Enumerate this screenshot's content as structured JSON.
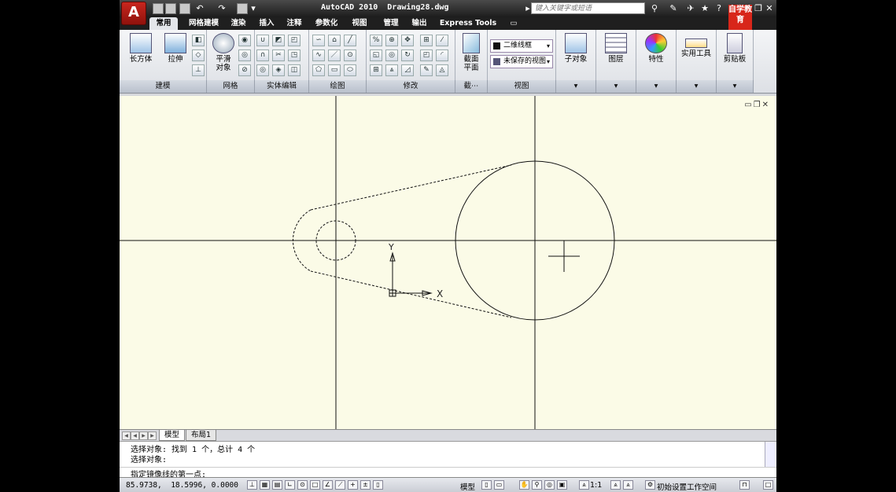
{
  "window": {
    "title": "AutoCAD 2010  Drawing28.dwg",
    "search_placeholder": "键入关键字或短语",
    "brand_logo_text": "自学教育"
  },
  "tabs": [
    {
      "label": "常用",
      "active": true
    },
    {
      "label": "网格建模"
    },
    {
      "label": "渲染"
    },
    {
      "label": "插入"
    },
    {
      "label": "注释"
    },
    {
      "label": "参数化"
    },
    {
      "label": "视图"
    },
    {
      "label": "管理"
    },
    {
      "label": "输出"
    },
    {
      "label": "Express Tools"
    }
  ],
  "ribbon": {
    "panels": {
      "modeling": "建模",
      "mesh": "网格",
      "solid_editing": "实体编辑",
      "draw": "绘图",
      "modify": "修改",
      "section": "截⋯",
      "view": "视图"
    },
    "buttons": {
      "box": "长方体",
      "extrude": "拉伸",
      "smooth_object": "平滑\n对象",
      "section_plane": "截面\n平面",
      "subobject": "子对象",
      "layers": "图层",
      "properties": "特性",
      "utilities": "实用工具",
      "clipboard": "剪贴板"
    },
    "visual_style": "二维线框",
    "saved_view": "未保存的视图"
  },
  "layout_tabs": [
    "模型",
    "布局1"
  ],
  "command": {
    "history": [
      "选择对象: 找到 1 个，总计 4 个",
      "选择对象:"
    ],
    "prompt": "指定镜像线的第一点:"
  },
  "status": {
    "coordinates": "85.9738,  18.5996, 0.0000",
    "model_label": "模型",
    "annotation_scale": "1:1",
    "workspace": "初始设置工作空间"
  },
  "ucs": {
    "x_label": "X",
    "y_label": "Y"
  }
}
